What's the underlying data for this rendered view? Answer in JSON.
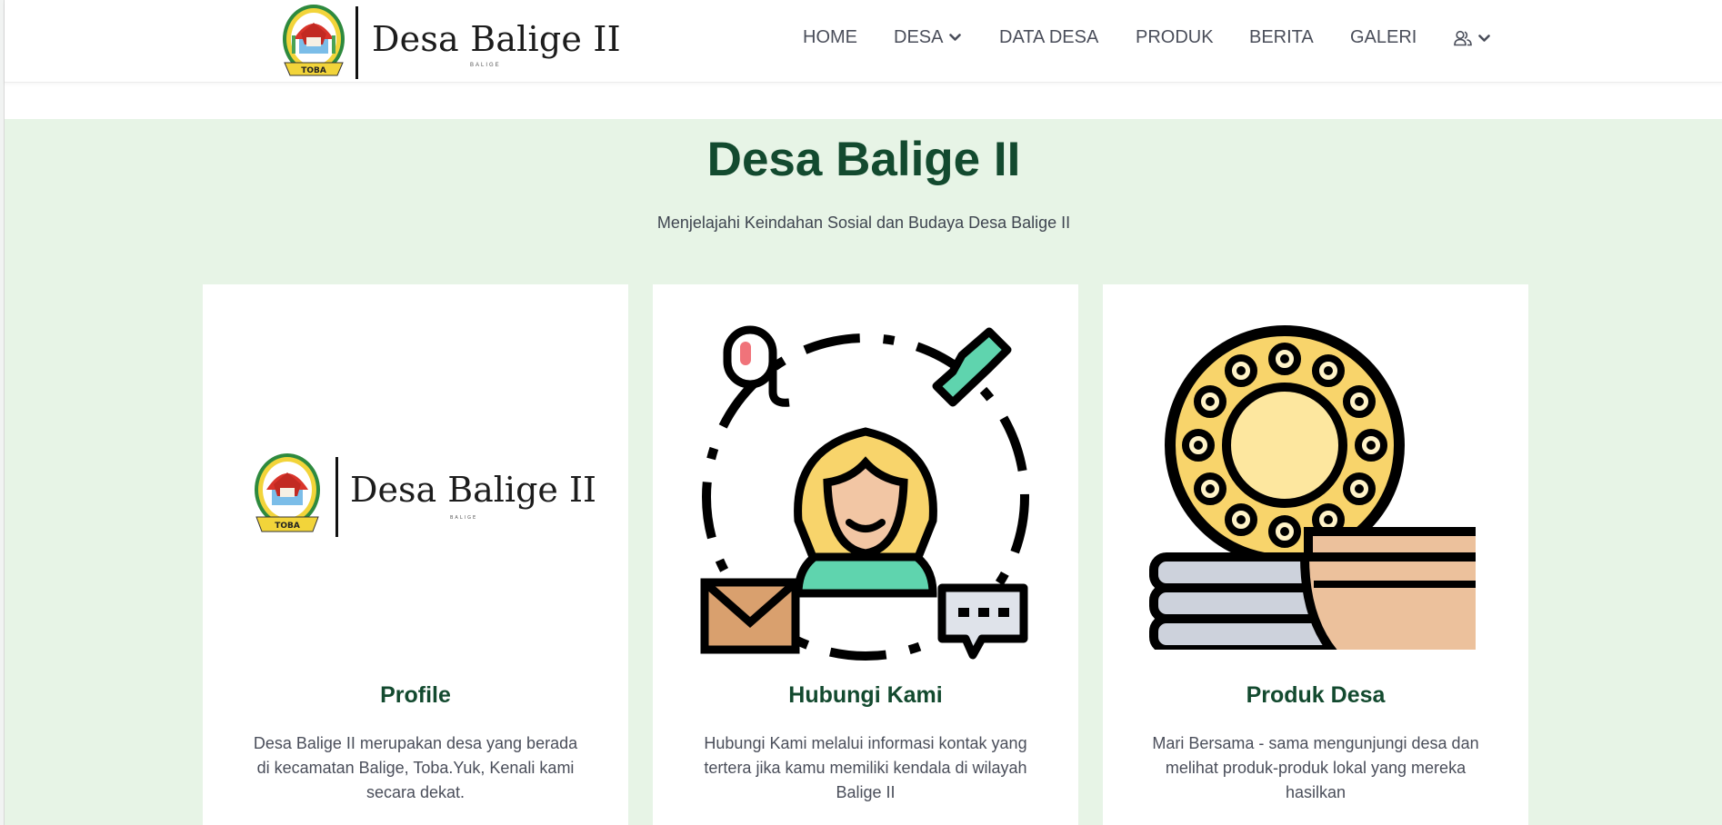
{
  "brand": {
    "name": "Desa Balige II",
    "sub": "BALIGE",
    "emblem_label": "TOBA",
    "emblem_icon": "toba-regency-emblem-icon"
  },
  "nav": {
    "home": "HOME",
    "desa": "DESA",
    "data_desa": "DATA DESA",
    "produk": "PRODUK",
    "berita": "BERITA",
    "galeri": "GALERI",
    "user_icon": "users-icon",
    "caret_icon": "chevron-down-icon"
  },
  "hero": {
    "title": "Desa Balige II",
    "subtitle": "Menjelajahi Keindahan Sosial dan Budaya Desa Balige II"
  },
  "cards": [
    {
      "title": "Profile",
      "text": "Desa Balige II merupakan desa yang berada di kecamatan Balige, Toba.Yuk, Kenali kami secara dekat.",
      "image_icon": "desa-balige-logo-image"
    },
    {
      "title": "Hubungi Kami",
      "text": "Hubungi Kami melalui informasi kontak yang tertera jika kamu memiliki kendala di wilayah Balige II",
      "image_icon": "contact-support-woman-icon"
    },
    {
      "title": "Produk Desa",
      "text": "Mari Bersama - sama mengunjungi desa dan melihat produk-produk lokal yang mereka hasilkan",
      "image_icon": "local-products-basket-plates-icon"
    }
  ],
  "colors": {
    "hero_bg": "#e7f4e6",
    "heading_green": "#134a2f",
    "nav_text": "#4a4e5a"
  }
}
